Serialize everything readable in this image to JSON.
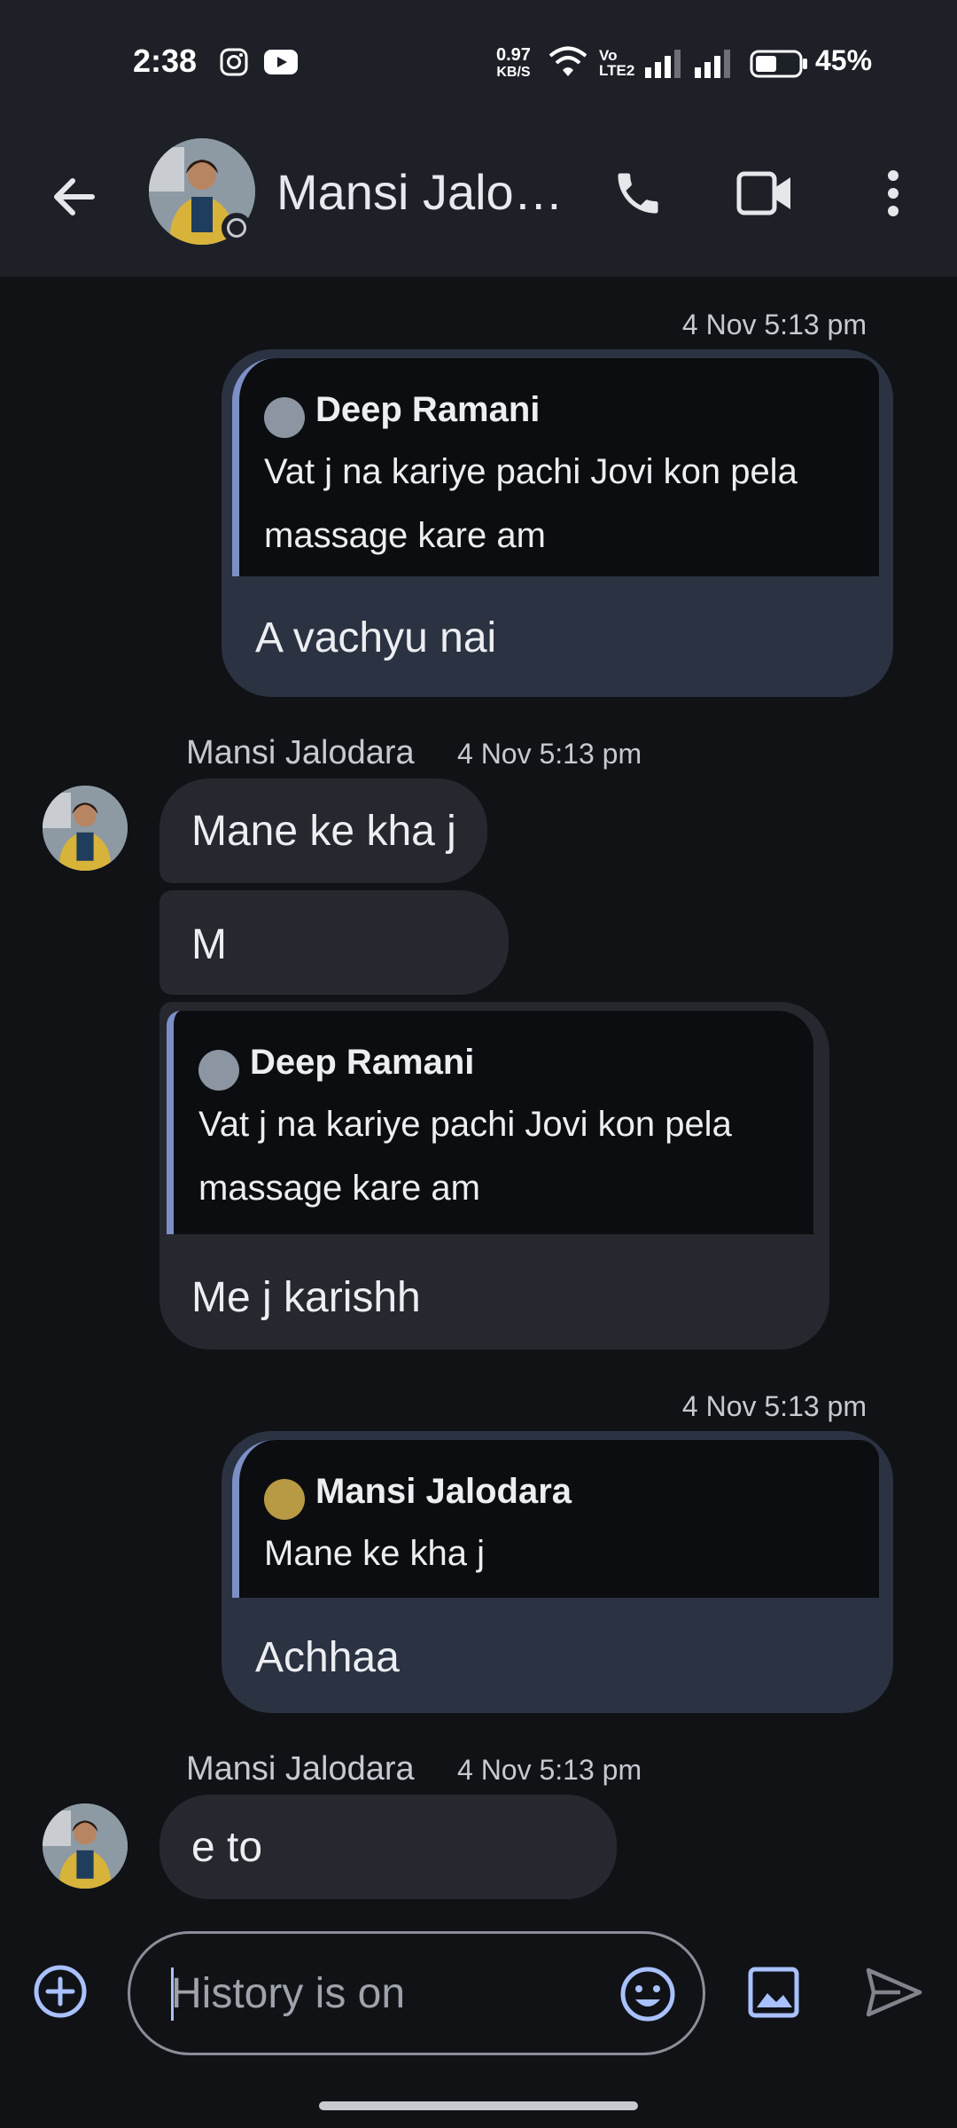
{
  "status_bar": {
    "time": "2:38",
    "speed_value": "0.97",
    "speed_unit": "KB/S",
    "volte_top": "Vo",
    "volte_bottom": "LTE2",
    "battery_pct": "45%",
    "icons": [
      "instagram-icon",
      "youtube-icon",
      "wifi-icon",
      "signal-icon",
      "signal-icon",
      "battery-icon"
    ]
  },
  "header": {
    "contact_name": "Mansi Jalo…",
    "icons": [
      "back-arrow-icon",
      "phone-icon",
      "video-call-icon",
      "more-vert-icon"
    ]
  },
  "messages": [
    {
      "direction": "out",
      "timestamp": "4 Nov 5:13 pm",
      "quote_name": "Deep Ramani",
      "quote_text": "Vat j na kariye pachi Jovi kon pela massage kare am",
      "text": "A vachyu nai"
    },
    {
      "direction": "in",
      "sender": "Mansi Jalodara",
      "timestamp": "4 Nov 5:13 pm",
      "text": "Mane ke kha j"
    },
    {
      "direction": "in",
      "text": "M"
    },
    {
      "direction": "in",
      "quote_name": "Deep Ramani",
      "quote_text": "Vat j na kariye pachi Jovi kon pela massage kare am",
      "text": "Me j karishh"
    },
    {
      "direction": "out",
      "timestamp": "4 Nov 5:13 pm",
      "quote_name": "Mansi Jalodara",
      "quote_text": "Mane ke kha j",
      "text": "Achhaa"
    },
    {
      "direction": "in",
      "sender": "Mansi Jalodara",
      "timestamp": "4 Nov 5:13 pm",
      "text": "e to"
    }
  ],
  "compose": {
    "placeholder": "History is on",
    "icons": [
      "add-circle-icon",
      "emoji-icon",
      "image-icon",
      "send-icon"
    ]
  },
  "colors": {
    "accent": "#a9c1ff",
    "background": "#101216",
    "header": "#1d2027",
    "bubble_in": "#25282e",
    "bubble_out": "#2b3242",
    "quote_bar": "#7c8fc6"
  }
}
